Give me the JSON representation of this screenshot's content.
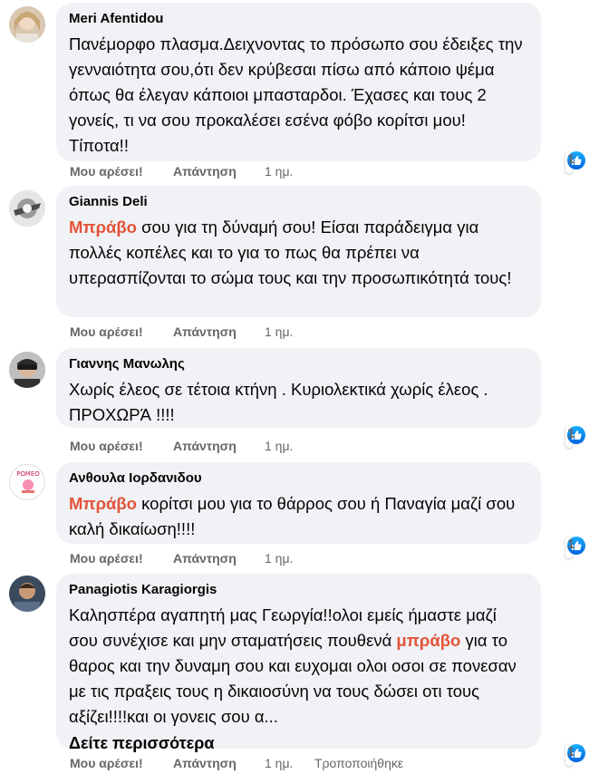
{
  "comments": [
    {
      "author": "Meri Afentidou",
      "text": "Πανέμορφο πλασμα.Δειχνοντας το πρόσωπο σου έδειξες την γενναιότητα σου,ότι δεν κρύβεσαι πίσω από κάποιο ψέμα όπως θα έλεγαν κάποιοι μπασταρδοι. Έχασες και τους 2 γονείς, τι να σου προκαλέσει εσένα φόβο κορίτσι μου! Τίποτα!!",
      "like_label": "Μου αρέσει!",
      "reply_label": "Απάντηση",
      "time": "1 ημ.",
      "reactions": "1"
    },
    {
      "author": "Giannis Deli",
      "keyword": "Μπράβο",
      "text": " σου για τη δύναμή σου! Είσαι παράδειγμα για πολλές κοπέλες και το για το πως θα πρέπει να υπερασπίζονται το σώμα τους και την προσωπικότητά τους!",
      "like_label": "Μου αρέσει!",
      "reply_label": "Απάντηση",
      "time": "1 ημ."
    },
    {
      "author": "Γιαννης Μανωλης",
      "text": "Χωρίς έλεος σε τέτοια κτήνη . Κυριολεκτικά χωρίς έλεος . ΠΡΟΧΩΡΆ !!!!",
      "like_label": "Μου αρέσει!",
      "reply_label": "Απάντηση",
      "time": "1 ημ.",
      "reactions": "1"
    },
    {
      "author": "Ανθουλα Ιορδανιδου",
      "keyword": "Μπράβο",
      "text": " κορίτσι μου για το θάρρος σου ή Παναγία μαζί σου καλή δικαίωση!!!!",
      "like_label": "Μου αρέσει!",
      "reply_label": "Απάντηση",
      "time": "1 ημ.",
      "reactions": "1"
    },
    {
      "author": "Panagiotis Karagiorgis",
      "text_before": "Καλησπέρα αγαπητή μας Γεωργία!!ολοι εμείς ήμαστε μαζί σου συνέχισε και μην σταματήσεις πουθενά ",
      "keyword": "μπράβο",
      "text_after": " για το θαρος και την δυναμη σου και ευχομαι ολοι οσοι σε πονεσαν με τις πραξεις τους η δικαιοσύνη να τους δώσει οτι τους αξίζει!!!!και οι γονεις σου α...",
      "see_more": "Δείτε περισσότερα",
      "like_label": "Μου αρέσει!",
      "reply_label": "Απάντηση",
      "time": "1 ημ.",
      "edited": "Τροποποιήθηκε",
      "reactions": "1"
    }
  ],
  "colors": {
    "keyword": "#e4533a",
    "bubble": "#f0f2f5",
    "meta": "#65676b",
    "like": "#1877f2"
  }
}
